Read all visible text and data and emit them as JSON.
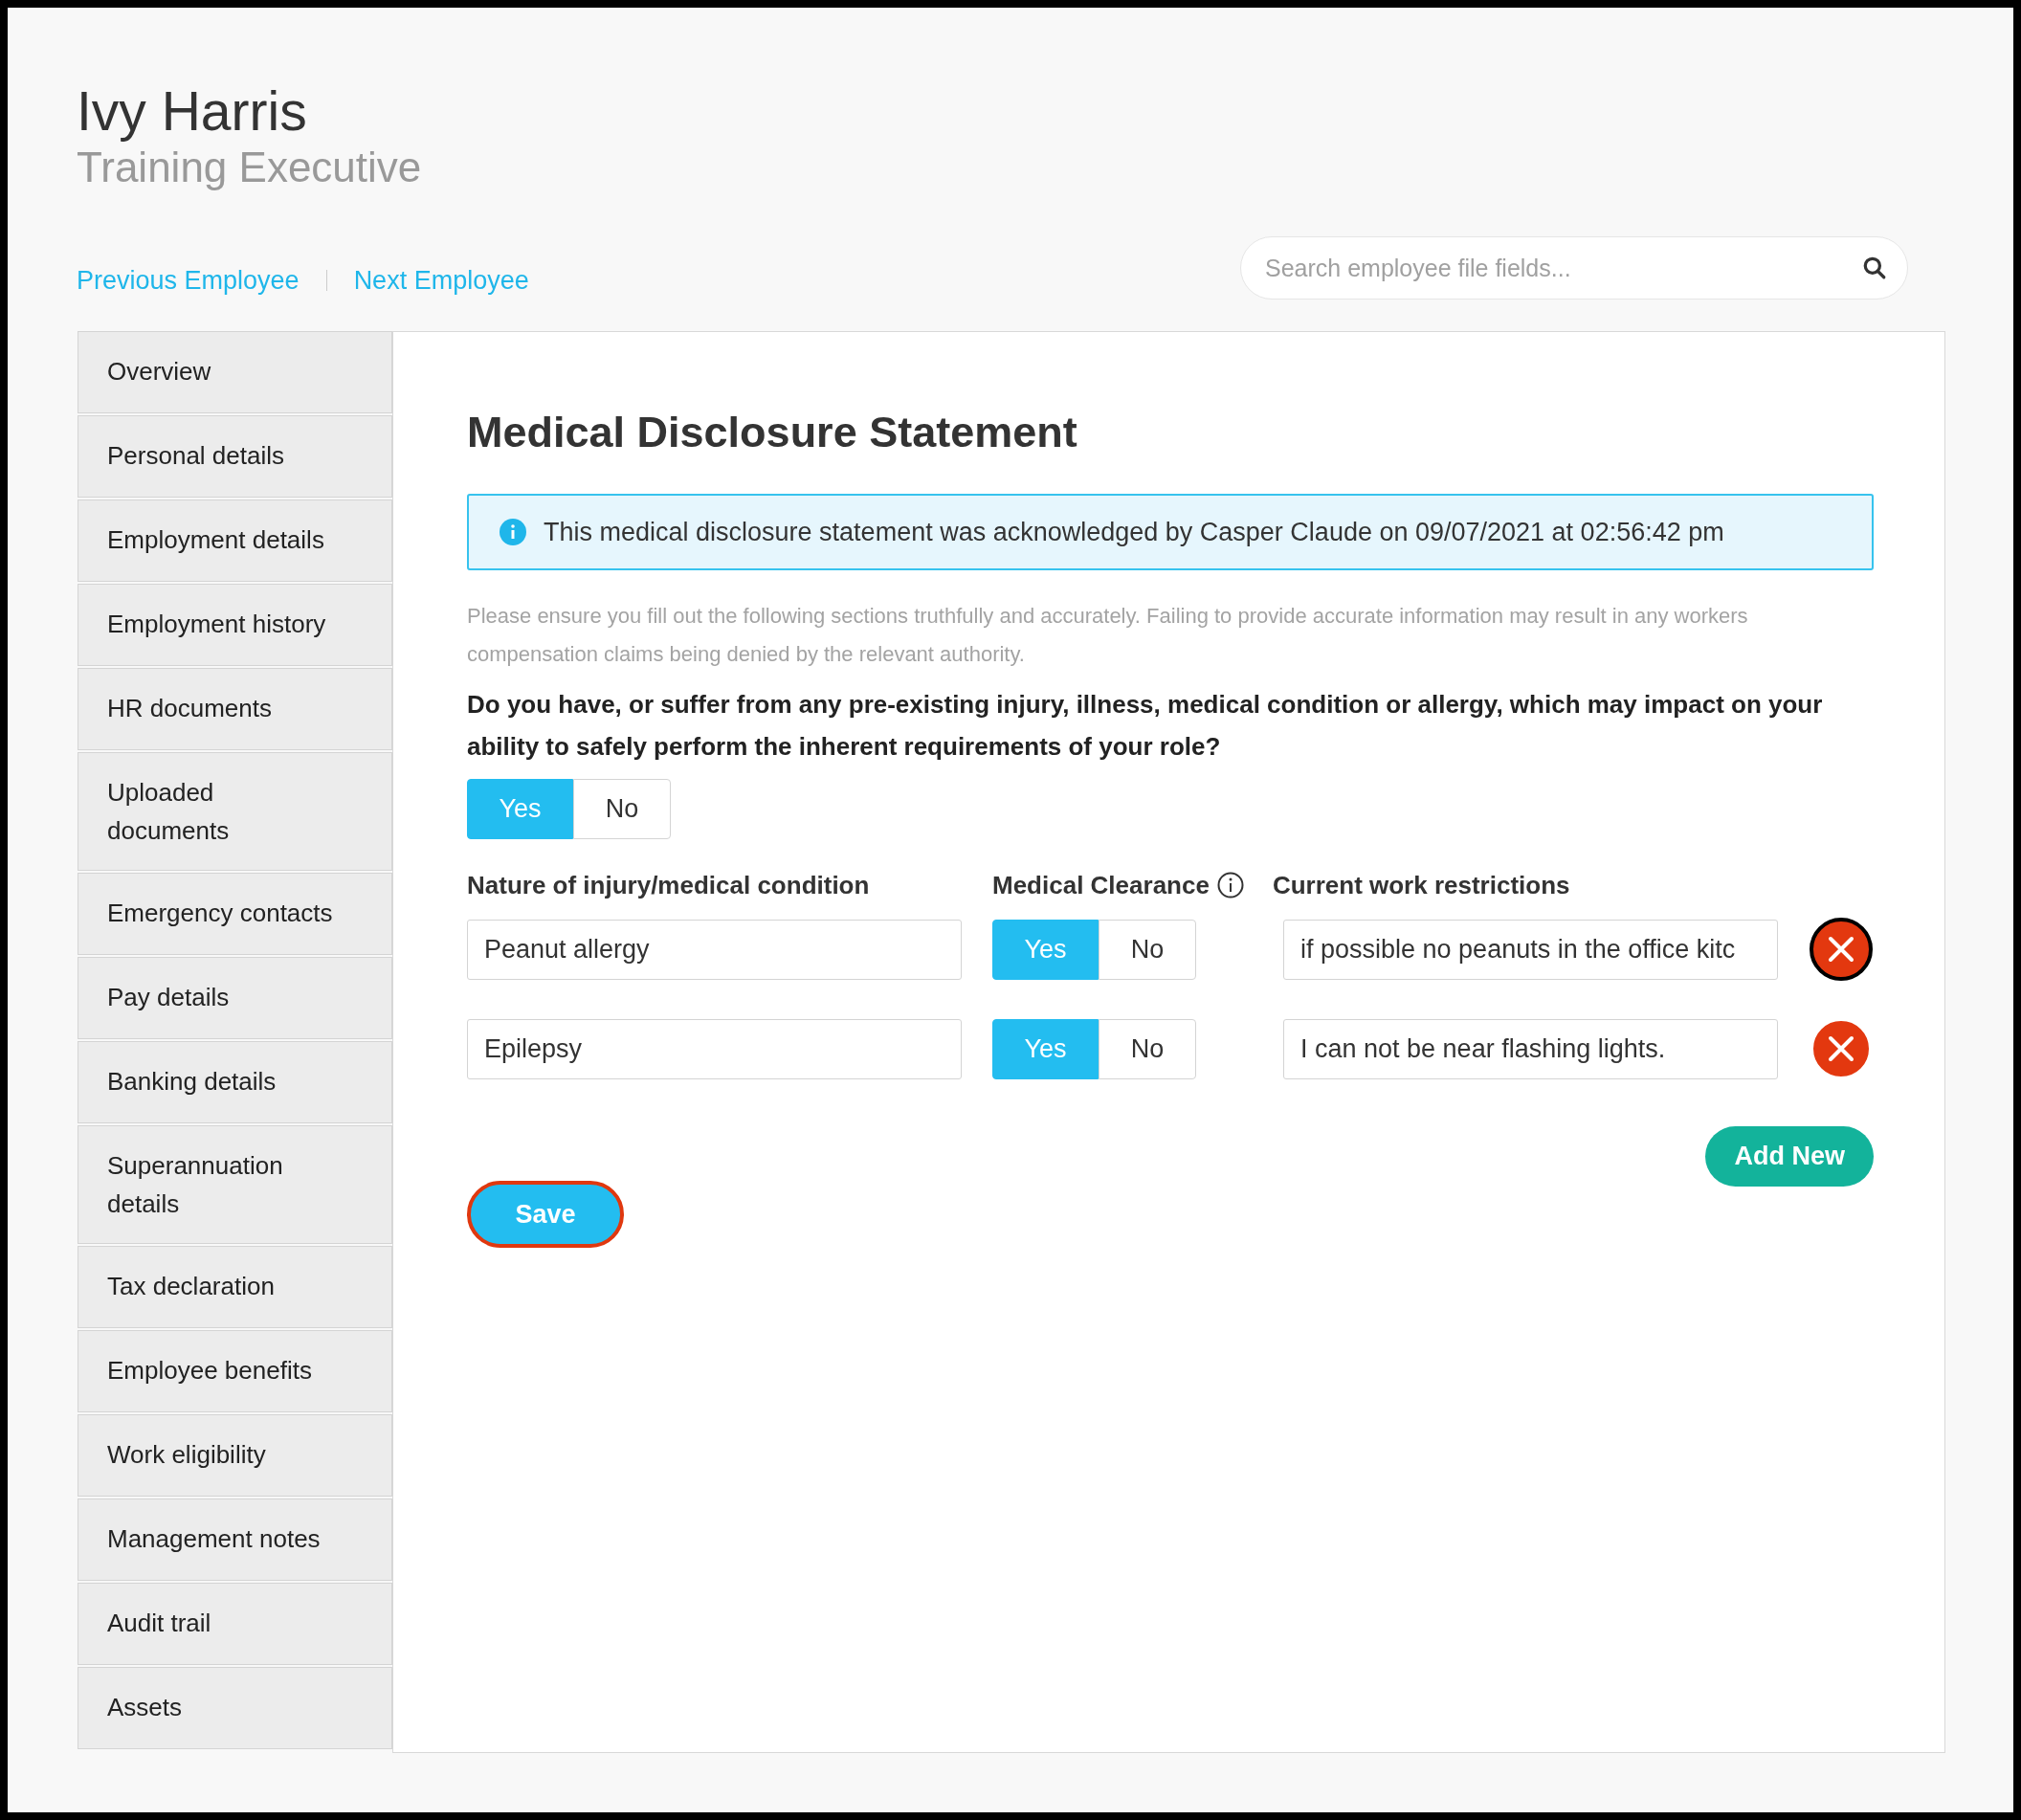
{
  "employee": {
    "name": "Ivy Harris",
    "title": "Training Executive"
  },
  "nav_links": [
    "Previous Employee",
    "Next Employee"
  ],
  "search": {
    "placeholder": "Search employee file fields..."
  },
  "sidebar": {
    "items": [
      "Overview",
      "Personal details",
      "Employment details",
      "Employment history",
      "HR documents",
      "Uploaded documents",
      "Emergency contacts",
      "Pay details",
      "Banking details",
      "Superannuation details",
      "Tax declaration",
      "Employee benefits",
      "Work eligibility",
      "Management notes",
      "Audit trail",
      "Assets"
    ]
  },
  "form": {
    "heading": "Medical Disclosure Statement",
    "notice": "This medical disclosure statement was acknowledged by Casper Claude on 09/07/2021 at 02:56:42 pm",
    "intro": "Please ensure you fill out the following sections truthfully and accurately. Failing to provide accurate information may result in any workers compensation claims being denied by the relevant authority.",
    "question": "Do you have, or suffer from any pre-existing injury, illness, medical condition or allergy, which may impact on your ability to safely perform the inherent requirements of your role?",
    "answer": [
      {
        "label": "Yes",
        "selected": true
      },
      {
        "label": "No",
        "selected": false
      }
    ],
    "columns": [
      "Nature of injury/medical condition",
      "Medical Clearance",
      "Current work restrictions"
    ],
    "rows": [
      {
        "condition": "Peanut allergy",
        "clearance": [
          {
            "label": "Yes",
            "selected": true
          },
          {
            "label": "No",
            "selected": false
          }
        ],
        "restrictions": "if possible no peanuts in the office kitc",
        "remove_focused": true
      },
      {
        "condition": "Epilepsy",
        "clearance": [
          {
            "label": "Yes",
            "selected": true
          },
          {
            "label": "No",
            "selected": false
          }
        ],
        "restrictions": "I can not be near flashing lights.",
        "remove_focused": false
      }
    ],
    "add_button": "Add New",
    "save_button": {
      "label": "Save",
      "focused": true
    }
  }
}
